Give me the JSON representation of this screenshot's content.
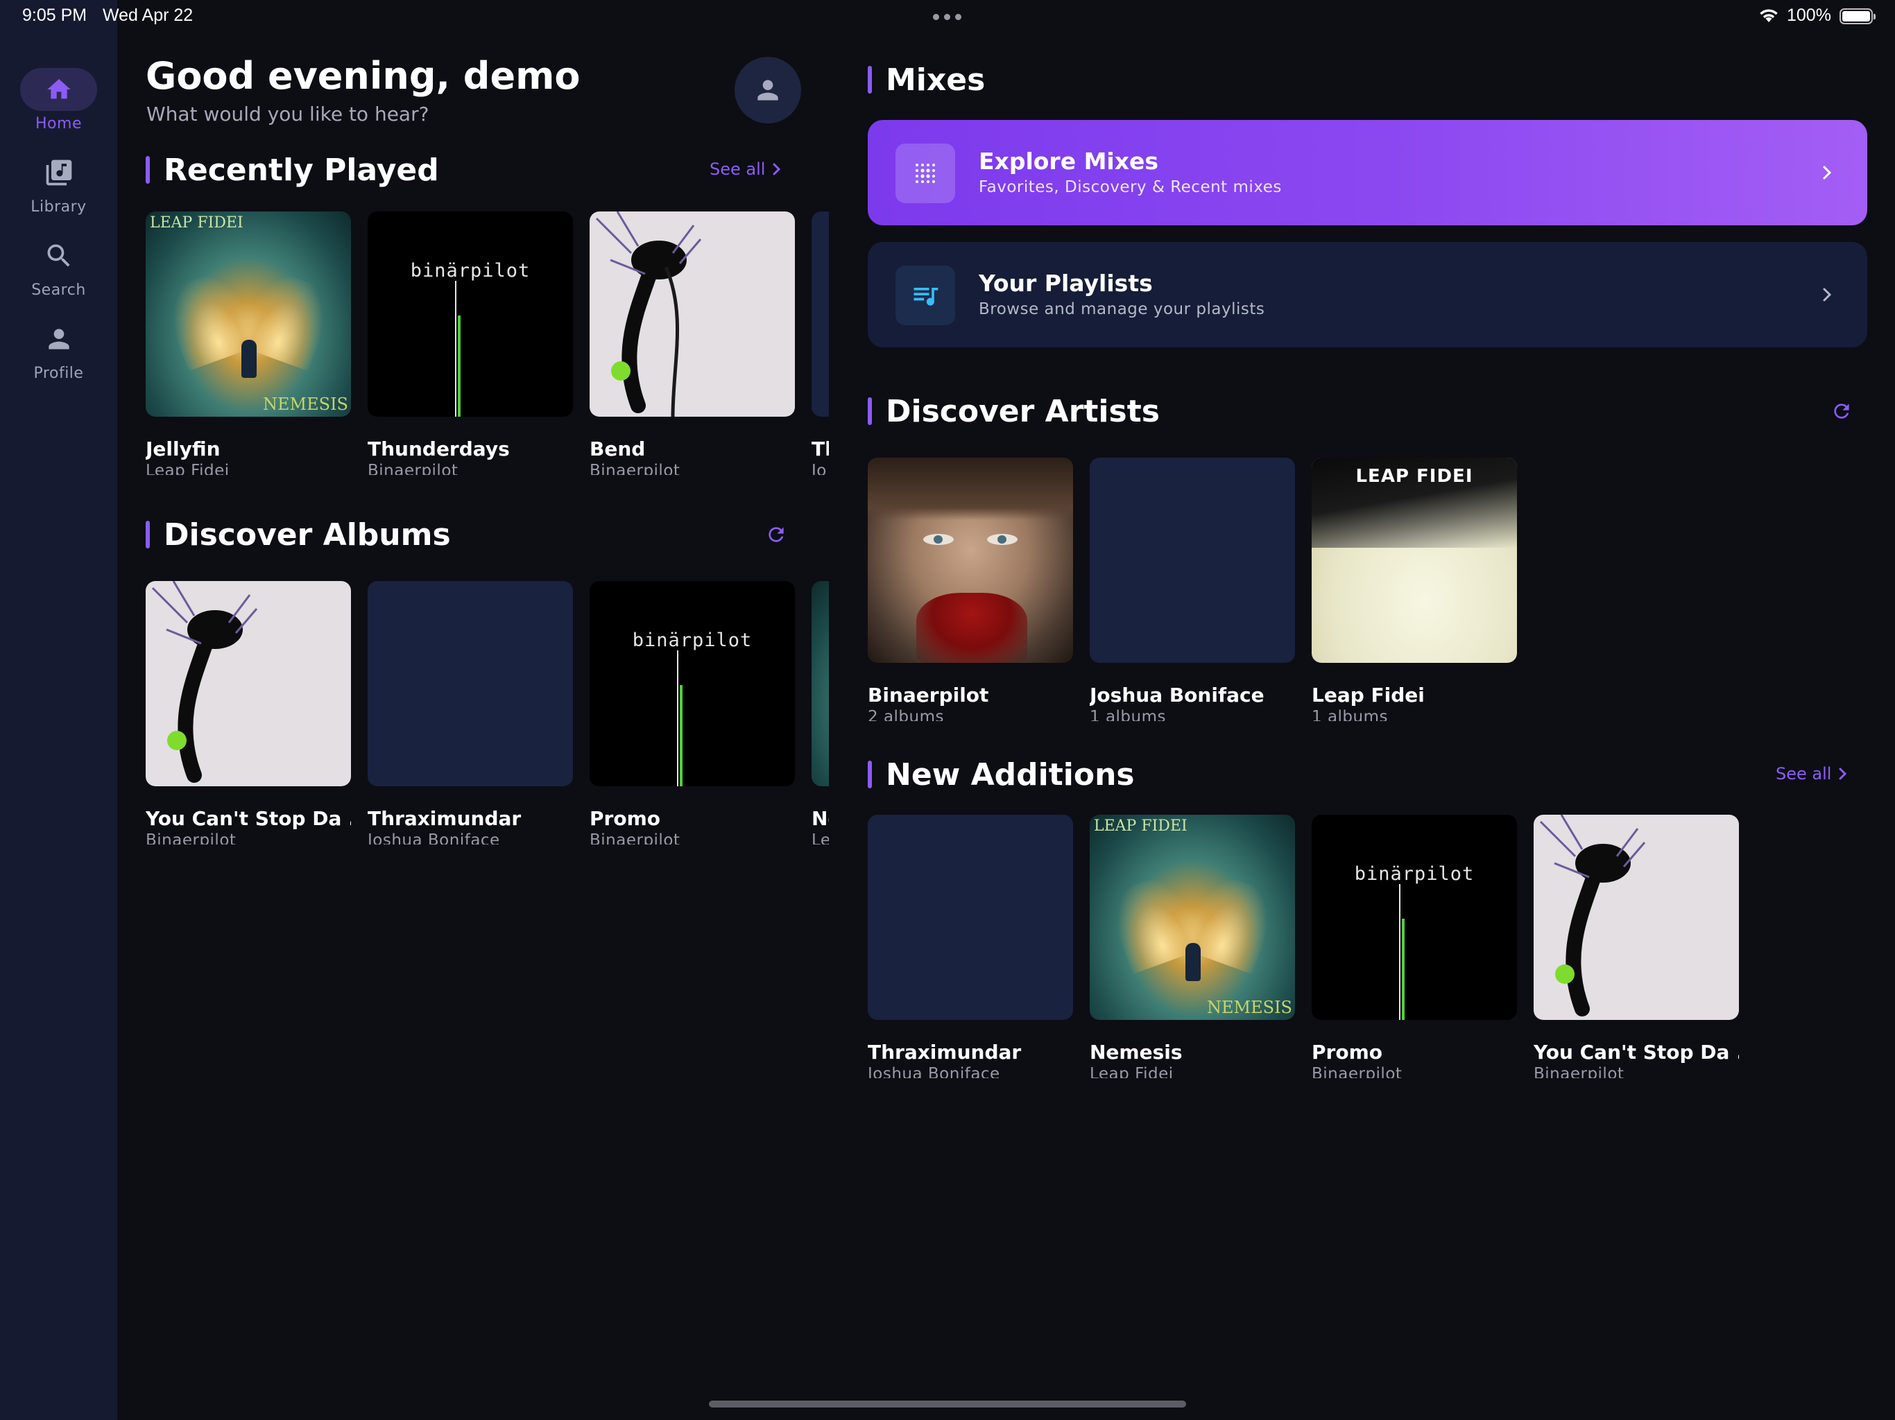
{
  "status_bar": {
    "time": "9:05 PM",
    "date": "Wed Apr 22",
    "battery": "100%"
  },
  "sidebar": {
    "items": [
      {
        "label": "Home",
        "icon": "home-icon",
        "active": true
      },
      {
        "label": "Library",
        "icon": "library-icon",
        "active": false
      },
      {
        "label": "Search",
        "icon": "search-icon",
        "active": false
      },
      {
        "label": "Profile",
        "icon": "profile-icon",
        "active": false
      }
    ]
  },
  "header": {
    "greeting": "Good evening, demo",
    "subtitle": "What would you like to hear?"
  },
  "recently_played": {
    "title": "Recently Played",
    "see_all": "See all",
    "items": [
      {
        "title": "Jellyfin",
        "subtitle": "Leap Fidei",
        "art": "nemesis",
        "art_text_top": "LEAP FIDEI",
        "art_text_bottom": "NEMESIS"
      },
      {
        "title": "Thunderdays",
        "subtitle": "Binaerpilot",
        "art": "binaerpilot",
        "art_text": "binärpilot"
      },
      {
        "title": "Bend",
        "subtitle": "Binaerpilot",
        "art": "bend"
      },
      {
        "title": "Th",
        "subtitle": "Jo",
        "art": "empty"
      }
    ]
  },
  "discover_albums": {
    "title": "Discover Albums",
    "items": [
      {
        "title": "You Can't Stop Da ...",
        "subtitle": "Binaerpilot",
        "art": "bend"
      },
      {
        "title": "Thraximundar",
        "subtitle": "Joshua Boniface",
        "art": "empty"
      },
      {
        "title": "Promo",
        "subtitle": "Binaerpilot",
        "art": "binaerpilot",
        "art_text": "binärpilot"
      },
      {
        "title": "Ne",
        "subtitle": "Le",
        "art": "nemesis"
      }
    ]
  },
  "mixes": {
    "title": "Mixes",
    "cards": [
      {
        "title": "Explore Mixes",
        "subtitle": "Favorites, Discovery & Recent mixes",
        "icon": "grid-dots-icon"
      },
      {
        "title": "Your Playlists",
        "subtitle": "Browse and manage your playlists",
        "icon": "playlist-icon"
      }
    ]
  },
  "discover_artists": {
    "title": "Discover Artists",
    "items": [
      {
        "title": "Binaerpilot",
        "subtitle": "2 albums",
        "art": "face"
      },
      {
        "title": "Joshua Boniface",
        "subtitle": "1 albums",
        "art": "empty"
      },
      {
        "title": "Leap Fidei",
        "subtitle": "1 albums",
        "art": "leap",
        "art_text": "LEAP FIDEI"
      }
    ]
  },
  "new_additions": {
    "title": "New Additions",
    "see_all": "See all",
    "items": [
      {
        "title": "Thraximundar",
        "subtitle": "Joshua Boniface",
        "art": "empty"
      },
      {
        "title": "Nemesis",
        "subtitle": "Leap Fidei",
        "art": "nemesis",
        "art_text_top": "LEAP FIDEI",
        "art_text_bottom": "NEMESIS"
      },
      {
        "title": "Promo",
        "subtitle": "Binaerpilot",
        "art": "binaerpilot",
        "art_text": "binärpilot"
      },
      {
        "title": "You Can't Stop Da ...",
        "subtitle": "Binaerpilot",
        "art": "bend"
      }
    ]
  },
  "colors": {
    "accent": "#8b5cf6",
    "background": "#0d0d14",
    "sidebar": "#161a30",
    "card": "#161d38",
    "placeholder": "#19223f"
  }
}
